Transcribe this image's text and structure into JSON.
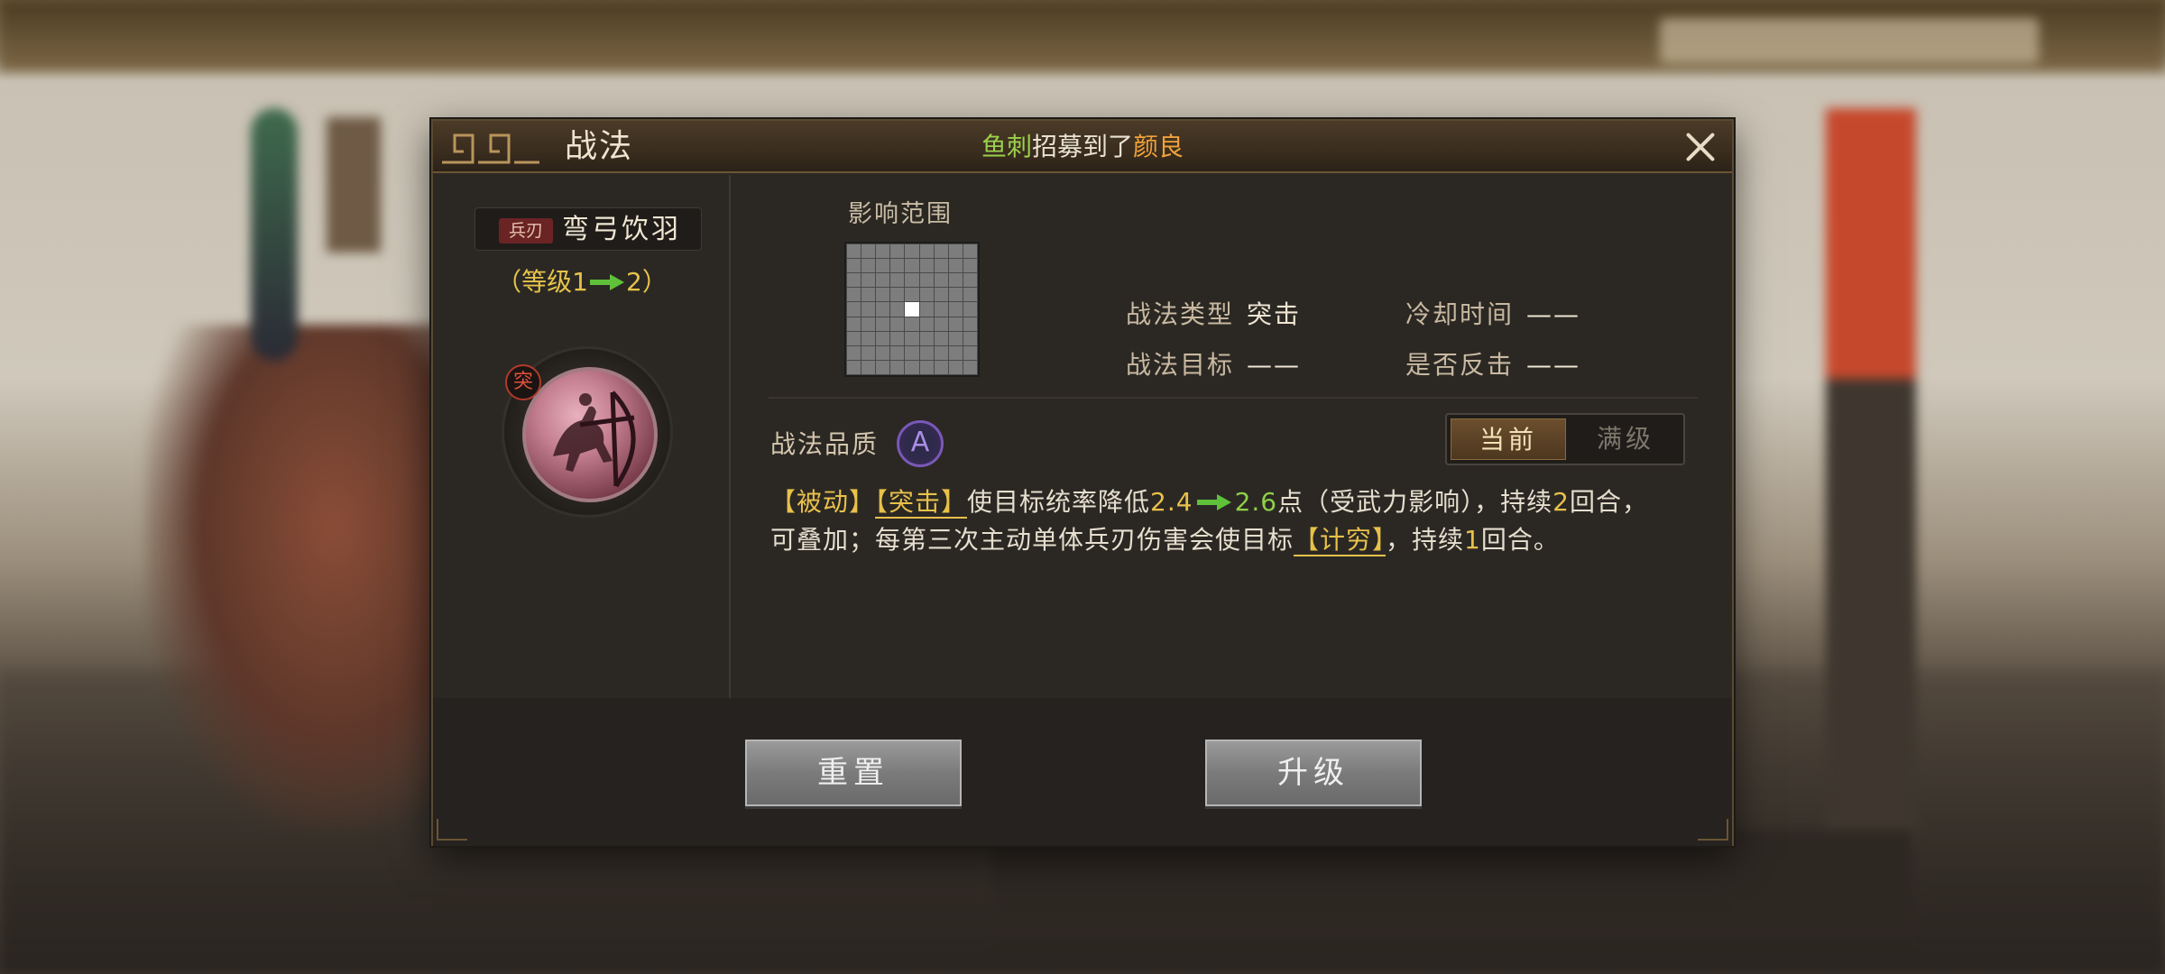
{
  "dialog": {
    "title": "战法",
    "notice": {
      "player": "鱼刺",
      "action": "招募到了",
      "general": "颜良"
    }
  },
  "skill": {
    "type_tag": "兵刃",
    "name": "弯弓饮羽",
    "level_prefix": "（等级",
    "level_from": "1",
    "level_to": "2",
    "level_suffix": "）",
    "emblem_badge": "突",
    "emblem_icon": "archer-cavalry-icon"
  },
  "range": {
    "title": "影响范围",
    "grid_size": 9,
    "center_highlight": true
  },
  "attributes": {
    "type_label": "战法类型",
    "type_value": "突击",
    "cooldown_label": "冷却时间",
    "cooldown_value": "——",
    "target_label": "战法目标",
    "target_value": "——",
    "counter_label": "是否反击",
    "counter_value": "——"
  },
  "quality": {
    "label": "战法品质",
    "grade": "A"
  },
  "toggle": {
    "current": "当前",
    "max": "满级"
  },
  "description": {
    "tag1": "【被动】",
    "tag2": "【突击】",
    "text1": "使目标统率降低",
    "from": "2.4",
    "to": "2.6",
    "text2": "点（受武力影响），持续",
    "turns1": "2",
    "text3": "回合，",
    "text4": "可叠加；每第三次主动单体兵刃伤害会使目标",
    "tag3": "【计穷】",
    "text5": "，持续",
    "turns2": "1",
    "text6": "回合。"
  },
  "buttons": {
    "reset": "重置",
    "upgrade": "升级"
  },
  "colors": {
    "accent_yellow": "#e8c14a",
    "accent_green": "#8fcf4a",
    "notice_orange": "#f0a23a",
    "quality_purple": "#7a58b7"
  }
}
